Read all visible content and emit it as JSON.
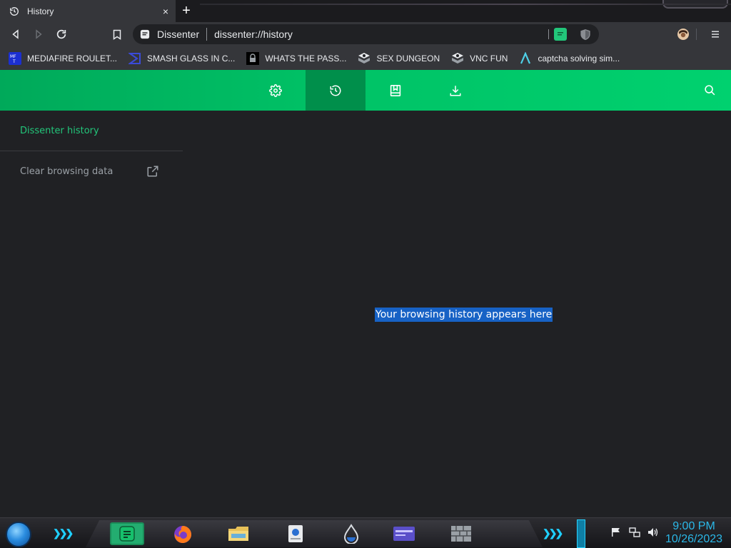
{
  "browser": {
    "tab": {
      "title": "History",
      "close": "×"
    },
    "new_tab": "+",
    "omnibox": {
      "site": "Dissenter",
      "url": "dissenter://history"
    },
    "bookmarks": [
      {
        "label": "MEDIAFIRE ROULET...",
        "icon": "mediafire-icon",
        "color": "#1b2fd1"
      },
      {
        "label": "SMASH GLASS IN C...",
        "icon": "smash-icon",
        "color": "#3b4bd8"
      },
      {
        "label": "WHATS THE PASS...",
        "icon": "pass-icon",
        "color": "#000000"
      },
      {
        "label": "SEX DUNGEON",
        "icon": "dungeon-icon",
        "color": "#cccccc"
      },
      {
        "label": "VNC FUN",
        "icon": "vnc-icon",
        "color": "#cccccc"
      },
      {
        "label": "captcha solving sim...",
        "icon": "captcha-icon",
        "color": "#4fd1e8"
      }
    ]
  },
  "app": {
    "accent": "#00c266",
    "nav": [
      "settings-icon",
      "history-icon",
      "bookmarks-icon",
      "downloads-icon"
    ],
    "active_nav": "history-icon",
    "sidebar": {
      "title": "Dissenter history",
      "clear": "Clear browsing data"
    },
    "empty_message": "Your browsing history appears here"
  },
  "taskbar": {
    "time": "9:00 PM",
    "date": "10/26/2023"
  }
}
